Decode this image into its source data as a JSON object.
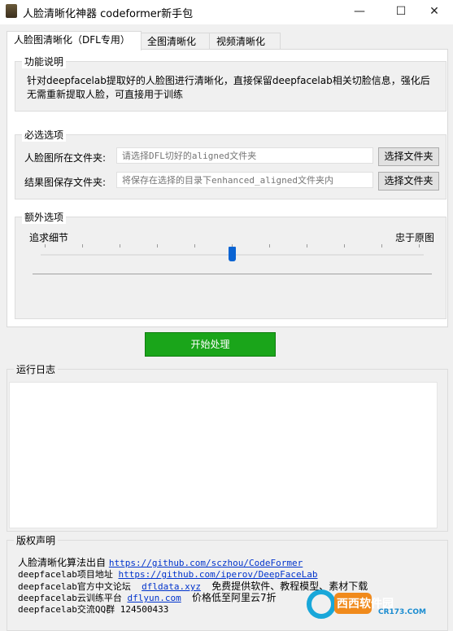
{
  "window": {
    "title": "人脸清晰化神器 codeformer新手包",
    "minimize": "—",
    "maximize": "☐",
    "close": "✕"
  },
  "tabs": [
    {
      "label": "人脸图清晰化（DFL专用）"
    },
    {
      "label": "全图清晰化"
    },
    {
      "label": "视频清晰化"
    }
  ],
  "description": {
    "title": "功能说明",
    "text": "针对deepfacelab提取好的人脸图进行清晰化，直接保留deepfacelab相关切脸信息，强化后无需重新提取人脸，可直接用于训练"
  },
  "required": {
    "title": "必选选项",
    "input_dir_label": "人脸图所在文件夹:",
    "input_dir_placeholder": "请选择DFL切好的aligned文件夹",
    "output_dir_label": "结果图保存文件夹:",
    "output_dir_placeholder": "将保存在选择的目录下enhanced_aligned文件夹内",
    "browse_label": "选择文件夹"
  },
  "extra": {
    "title": "额外选项",
    "left_label": "追求细节",
    "right_label": "忠于原图",
    "slider_fraction": 0.5
  },
  "start_button": "开始处理",
  "log": {
    "title": "运行日志"
  },
  "copyright": {
    "title": "版权声明",
    "line1_text": "人脸清晰化算法出自",
    "line1_link": "https://github.com/sczhou/CodeFormer",
    "line2_text": "deepfacelab项目地址",
    "line2_link": "https://github.com/iperov/DeepFaceLab",
    "line3_text": "deepfacelab官方中文论坛",
    "line3_link": "dfldata.xyz",
    "line3_tail": "免费提供软件、教程模型、素材下载",
    "line4_text": "deepfacelab云训练平台",
    "line4_link": "dflyun.com",
    "line4_tail": "价格低至阿里云7折",
    "line5_text": "deepfacelab交流QQ群 124500433"
  },
  "watermark": {
    "text": "西西软件园",
    "sub": "CR173.COM"
  }
}
